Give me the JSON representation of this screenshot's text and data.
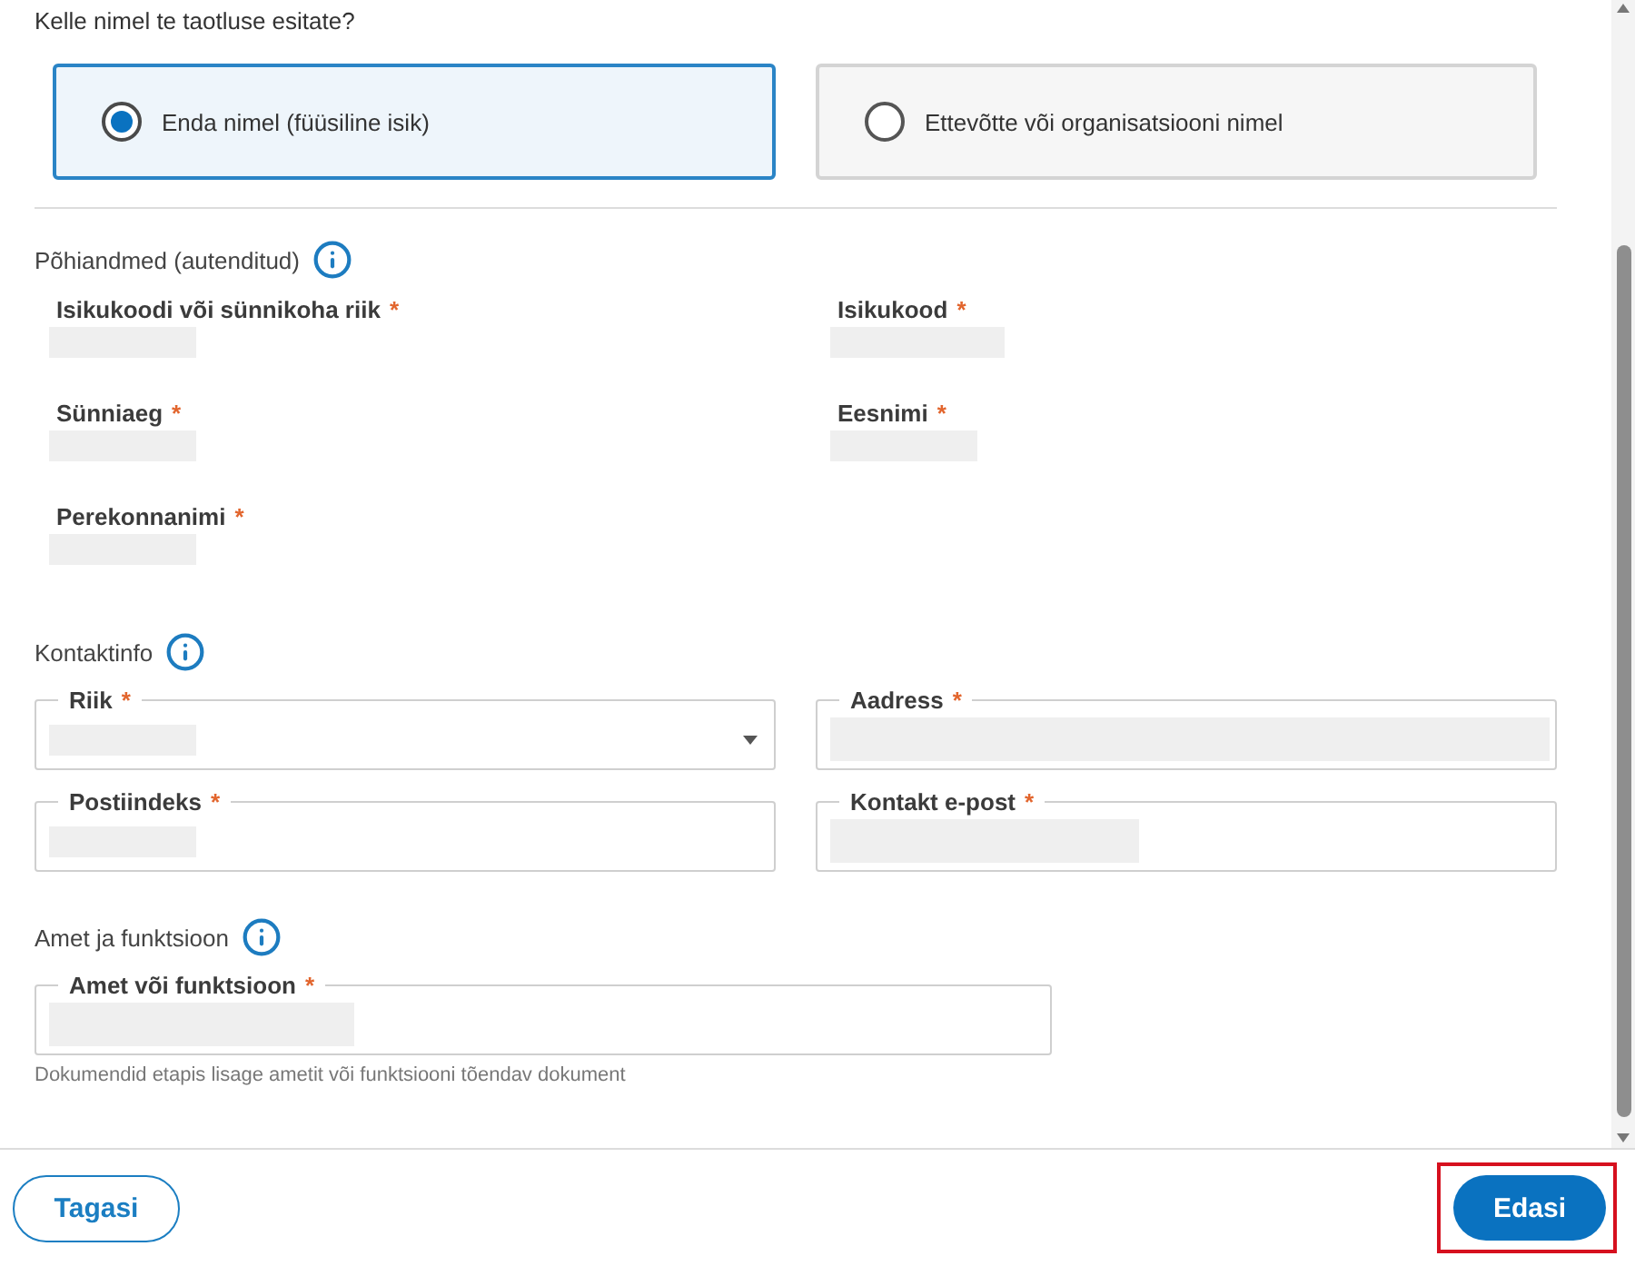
{
  "question": "Kelle nimel te taotluse esitate?",
  "applicant_options": [
    {
      "label": "Enda nimel (füüsiline isik)",
      "selected": true
    },
    {
      "label": "Ettevõtte või organisatsiooni nimel",
      "selected": false
    }
  ],
  "basic_data": {
    "title": "Põhiandmed (autenditud)",
    "fields": [
      {
        "label": "Isikukoodi või sünnikoha riik",
        "required_mark": "*",
        "redacted": true
      },
      {
        "label": "Isikukood",
        "required_mark": "*",
        "redacted": true
      },
      {
        "label": "Sünniaeg",
        "required_mark": "*",
        "redacted": true
      },
      {
        "label": "Eesnimi",
        "required_mark": "*",
        "redacted": true
      },
      {
        "label": "Perekonnanimi",
        "required_mark": "*",
        "redacted": true
      }
    ]
  },
  "contact_info": {
    "title": "Kontaktinfo",
    "fields": [
      {
        "kind": "select",
        "label": "Riik",
        "required_mark": "*",
        "redacted": true
      },
      {
        "kind": "text",
        "label": "Aadress",
        "required_mark": "*",
        "redacted": true
      },
      {
        "kind": "text",
        "label": "Postiindeks",
        "required_mark": "*",
        "redacted": true
      },
      {
        "kind": "text",
        "label": "Kontakt e-post",
        "required_mark": "*",
        "redacted": true
      }
    ]
  },
  "position": {
    "title": "Amet ja funktsioon",
    "fields": [
      {
        "kind": "text",
        "label": "Amet või funktsioon",
        "required_mark": "*",
        "redacted": true
      }
    ],
    "helper_text": "Dokumendid etapis lisage ametit või funktsiooni tõendav dokument"
  },
  "footer": {
    "back_button": {
      "label": "Tagasi"
    },
    "next_button": {
      "label": "Edasi",
      "highlighted": true
    }
  }
}
